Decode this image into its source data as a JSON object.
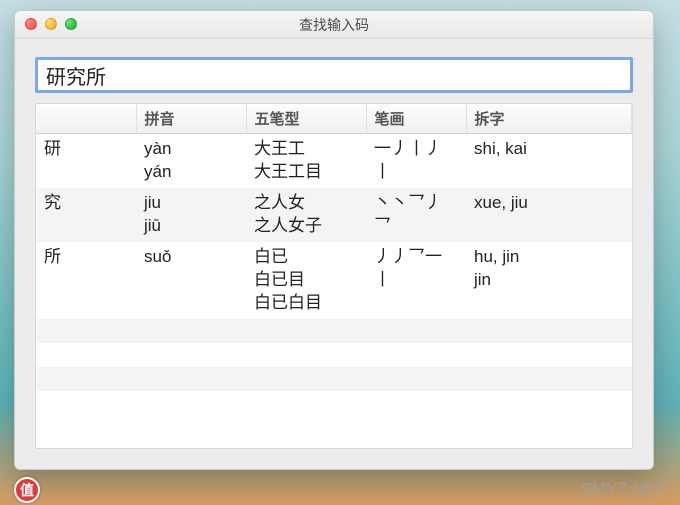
{
  "window": {
    "title": "查找输入码"
  },
  "search": {
    "value": "研究所"
  },
  "columns": {
    "c0": "",
    "c1": "拼音",
    "c2": "五笔型",
    "c3": "笔画",
    "c4": "拆字"
  },
  "rows": [
    {
      "char": "研",
      "pinyin": "yàn\nyán",
      "wubi": "大王工\n大王工目",
      "bihua": "一丿丨丿\n丨",
      "chaizi": "shi, kai"
    },
    {
      "char": "究",
      "pinyin": "jiu\njiū",
      "wubi": "之人女\n之人女子",
      "bihua": "丶丶乛丿\n乛",
      "chaizi": "xue, jiu"
    },
    {
      "char": "所",
      "pinyin": "suǒ",
      "wubi": "白已\n白已目\n白已白目",
      "bihua": "丿丿乛一\n丨",
      "chaizi": "hu, jin\njin"
    }
  ],
  "watermark": {
    "badge": "值",
    "text": "SMYZ.NET"
  }
}
